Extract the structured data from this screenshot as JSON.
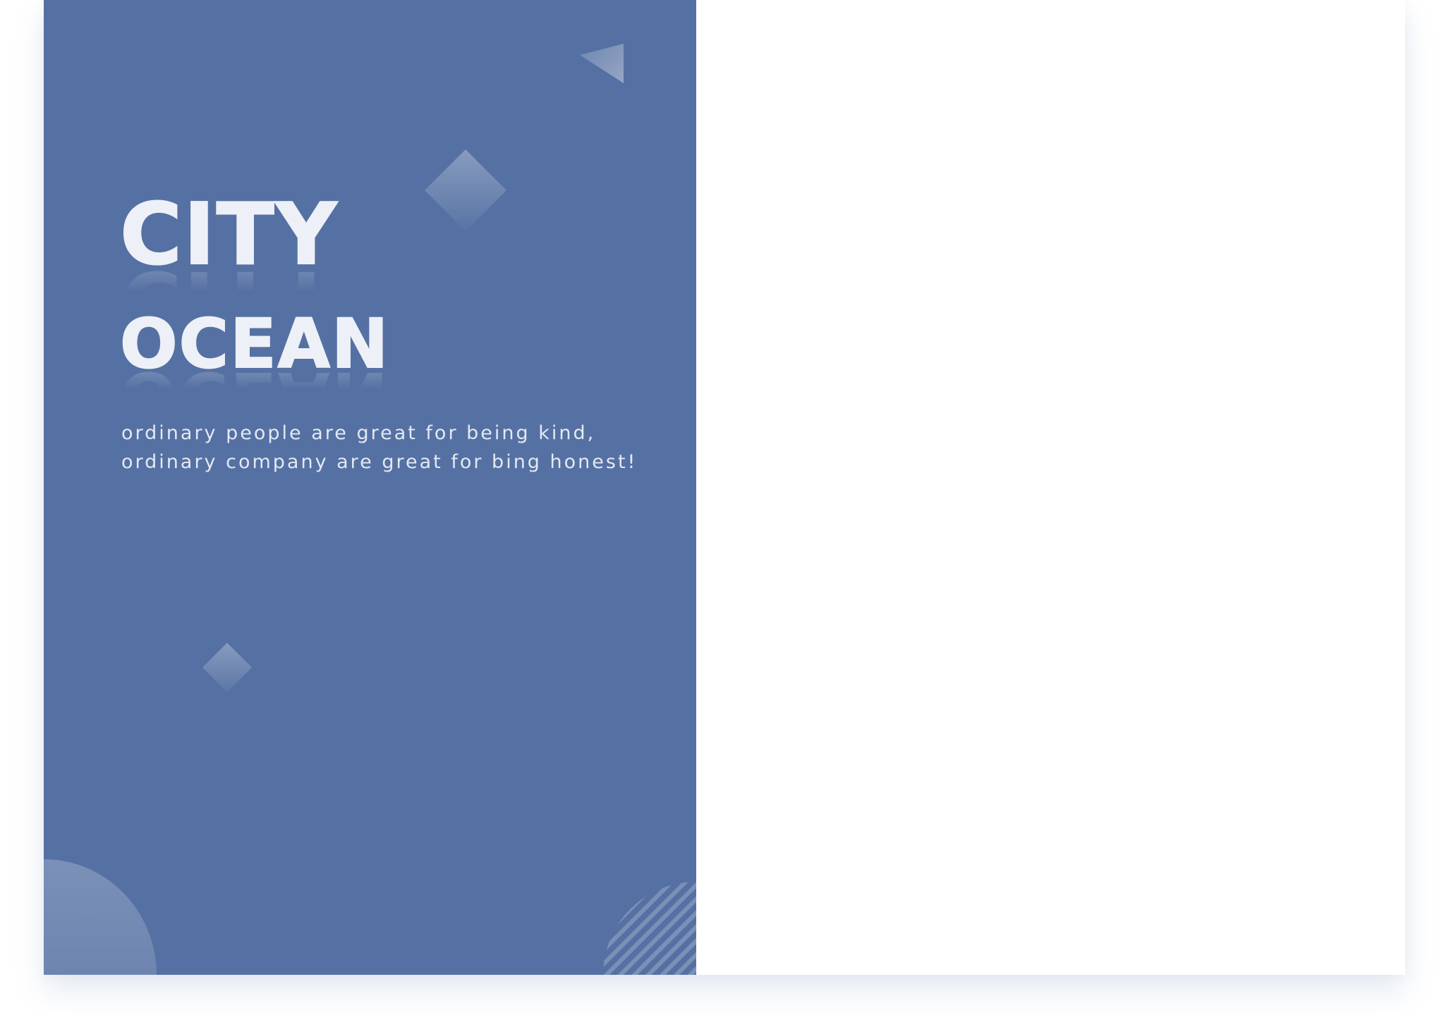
{
  "cover": {
    "title_line1": "CITY",
    "title_line2": "OCEAN",
    "tagline_line1": "ordinary people are great for being kind,",
    "tagline_line2": "ordinary company are great for bing honest!"
  },
  "colors": {
    "cover_background": "#5571a3",
    "title_text": "#eef0f7",
    "tagline_text": "#e3e8f3",
    "page_background": "#ffffff"
  },
  "icons": [
    "triangle-shape",
    "diamond-shape",
    "quarter-circle-shape",
    "striped-circle-shape"
  ]
}
